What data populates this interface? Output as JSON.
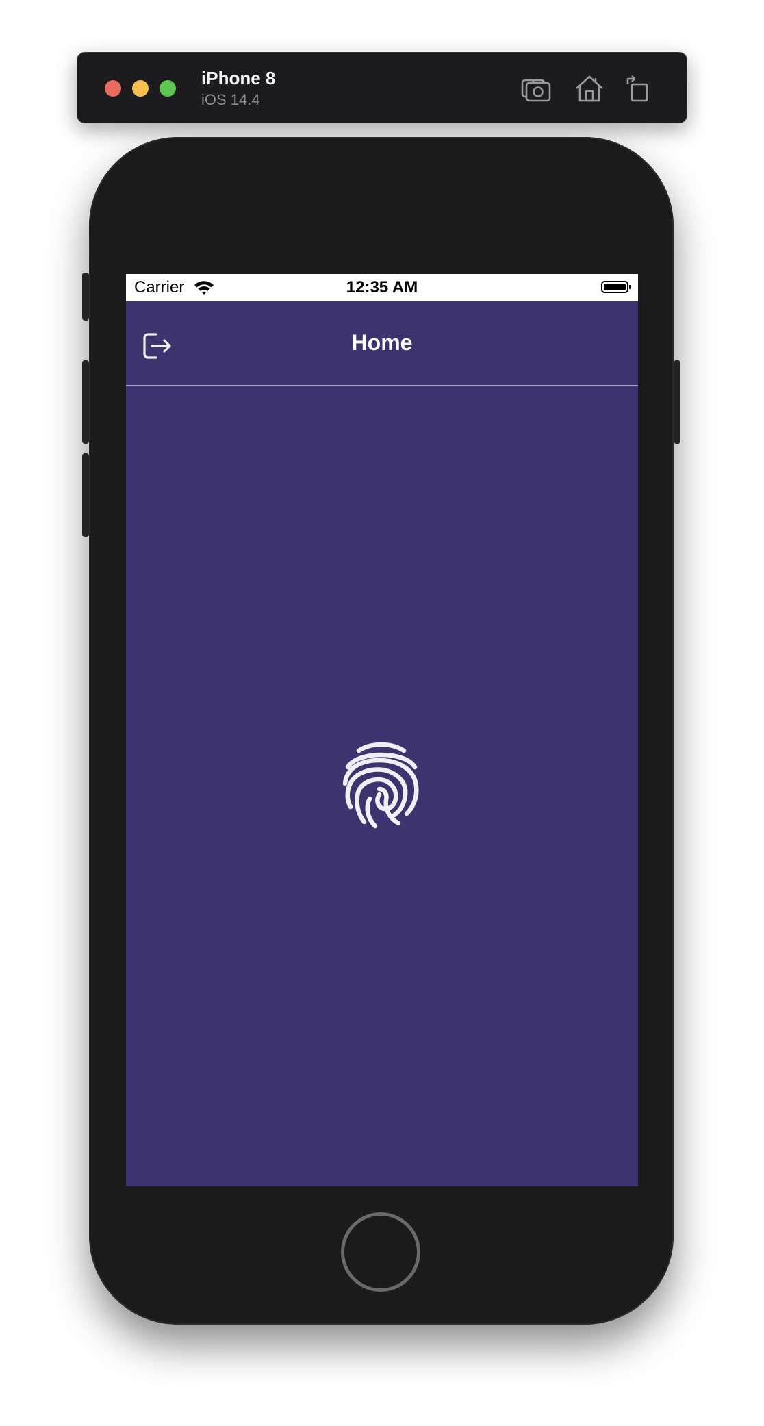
{
  "simulator": {
    "device_name": "iPhone 8",
    "os_version": "iOS 14.4",
    "toolbar_icons": [
      "screenshot-icon",
      "home-icon",
      "rotate-icon"
    ]
  },
  "status_bar": {
    "carrier": "Carrier",
    "time": "12:35 AM"
  },
  "nav": {
    "title": "Home",
    "left_icon": "logout-icon"
  },
  "content": {
    "center_icon": "fingerprint-icon"
  },
  "colors": {
    "screen_background": "#3d346f",
    "nav_divider": "#a39fbd",
    "icon_color": "#f2eef5"
  }
}
